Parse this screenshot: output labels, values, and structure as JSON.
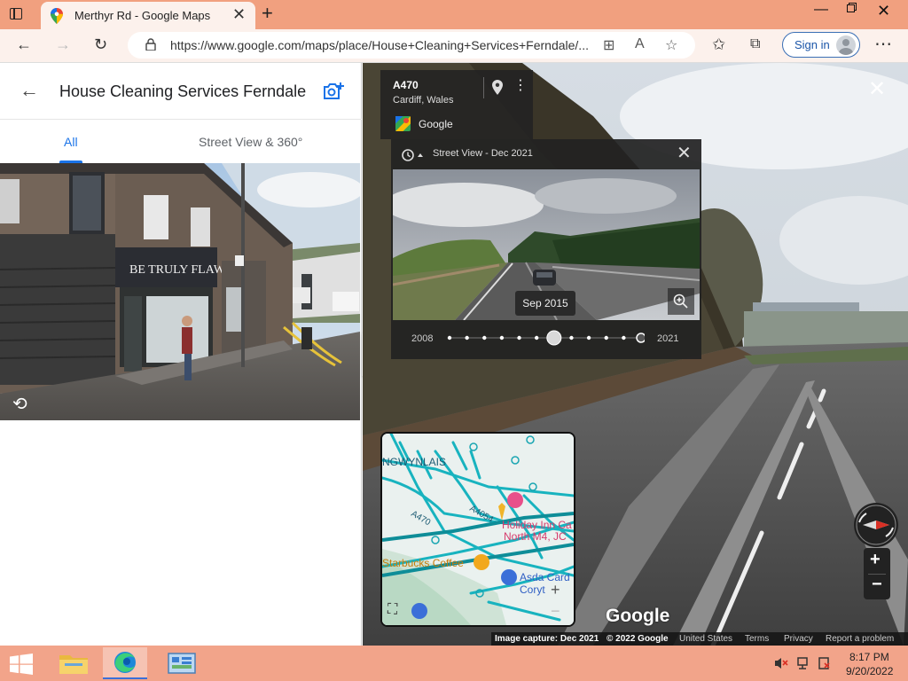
{
  "browser": {
    "tab": {
      "title": "Merthyr Rd - Google Maps"
    },
    "url": "https://www.google.com/maps/place/House+Cleaning+Services+Ferndale/...",
    "signin_label": "Sign in"
  },
  "left_panel": {
    "title": "House Cleaning Services Ferndale",
    "tabs": [
      {
        "label": "All",
        "active": true
      },
      {
        "label": "Street View & 360°",
        "active": false
      }
    ],
    "photo_sign": "BE TRULY FLAWLESS"
  },
  "street_view": {
    "road_name": "A470",
    "location": "Cardiff, Wales",
    "source": "Google",
    "time_travel": {
      "title": "Street View - Dec 2021",
      "selected_date": "Sep 2015",
      "year_start": "2008",
      "year_end": "2021",
      "timeline_count": 12,
      "selected_index": 6
    },
    "minimap": {
      "labels": [
        "NGWYNLAIS",
        "A470",
        "A4054",
        "Holiday Inn Ca",
        "North M4, JC",
        "Starbucks Coffee",
        "Asda Card",
        "Coryt"
      ]
    },
    "logo": "Google",
    "footer": {
      "capture": "Image capture: Dec 2021",
      "copyright": "© 2022 Google",
      "links": [
        "United States",
        "Terms",
        "Privacy",
        "Report a problem"
      ]
    }
  },
  "taskbar": {
    "time": "8:17 PM",
    "date": "9/20/2022"
  },
  "colors": {
    "titlebar": "#f1a07f",
    "taskbar": "#f2a48a",
    "accent_blue": "#1a73e8"
  }
}
